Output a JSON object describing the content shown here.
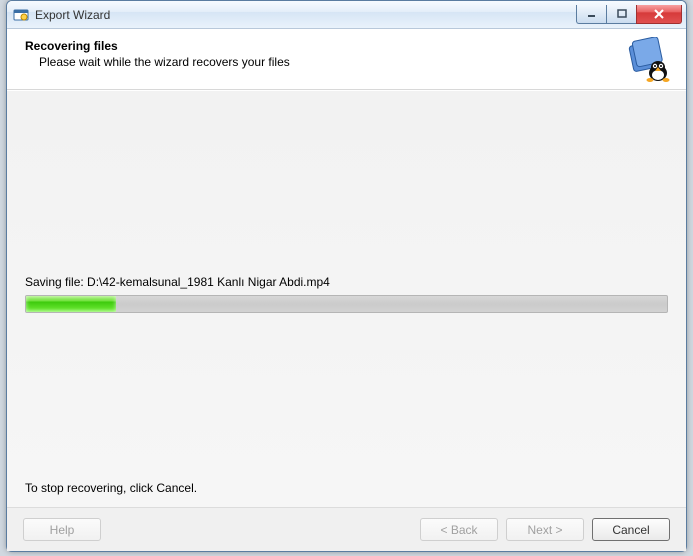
{
  "window": {
    "title": "Export Wizard"
  },
  "header": {
    "heading": "Recovering files",
    "subheading": "Please wait while the wizard recovers your files"
  },
  "content": {
    "status_prefix": "Saving file: ",
    "status_path": "D:\\42-kemalsunal_1981 Kanlı Nigar Abdi.mp4",
    "progress_percent": 14,
    "hint": "To stop recovering, click Cancel."
  },
  "buttons": {
    "help": "Help",
    "back": "< Back",
    "next": "Next >",
    "cancel": "Cancel"
  }
}
